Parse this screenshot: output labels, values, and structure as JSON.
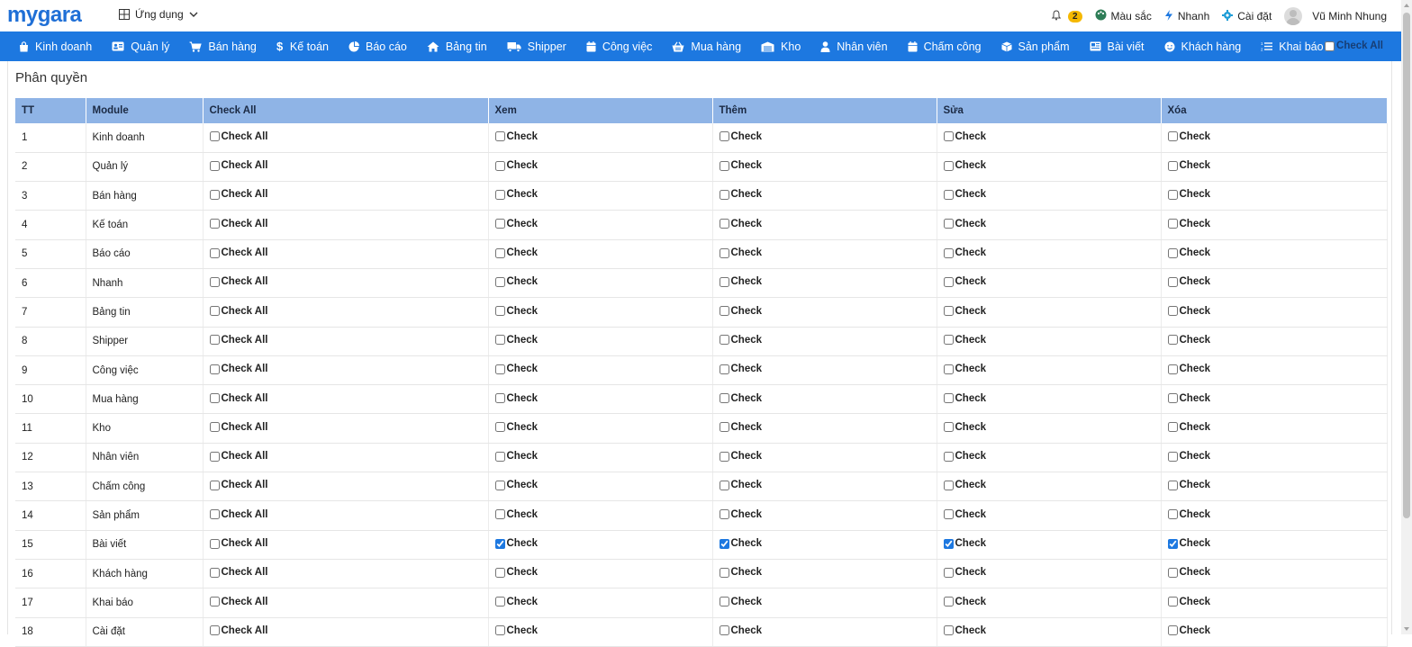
{
  "header": {
    "logo_part1": "my",
    "logo_part2": "gara",
    "apps_label": "Ứng dụng",
    "notification_count": "2",
    "color_label": "Màu sắc",
    "quick_label": "Nhanh",
    "settings_label": "Cài đặt",
    "user_name": "Vũ Minh Nhung"
  },
  "nav": {
    "items": [
      {
        "label": "Kinh doanh",
        "icon": "shopping-bag-icon"
      },
      {
        "label": "Quản lý",
        "icon": "id-card-icon"
      },
      {
        "label": "Bán hàng",
        "icon": "cart-icon"
      },
      {
        "label": "Kế toán",
        "icon": "dollar-icon"
      },
      {
        "label": "Báo cáo",
        "icon": "pie-chart-icon"
      },
      {
        "label": "Bảng tin",
        "icon": "home-icon"
      },
      {
        "label": "Shipper",
        "icon": "truck-icon"
      },
      {
        "label": "Công việc",
        "icon": "calendar-icon"
      },
      {
        "label": "Mua hàng",
        "icon": "basket-icon"
      },
      {
        "label": "Kho",
        "icon": "warehouse-icon"
      },
      {
        "label": "Nhân viên",
        "icon": "user-icon"
      },
      {
        "label": "Chấm công",
        "icon": "calendar-icon"
      },
      {
        "label": "Sản phẩm",
        "icon": "box-icon"
      },
      {
        "label": "Bài viết",
        "icon": "newspaper-icon"
      },
      {
        "label": "Khách hàng",
        "icon": "smile-icon"
      },
      {
        "label": "Khai báo",
        "icon": "list-icon"
      }
    ],
    "check_all_label": "Check All"
  },
  "page": {
    "title": "Phân quyền"
  },
  "table": {
    "headers": {
      "tt": "TT",
      "module": "Module",
      "check_all": "Check All",
      "view": "Xem",
      "add": "Thêm",
      "edit": "Sửa",
      "delete": "Xóa"
    },
    "check_all_label": "Check All",
    "check_label": "Check",
    "rows": [
      {
        "tt": "1",
        "module": "Kinh doanh",
        "view": false,
        "add": false,
        "edit": false,
        "delete": false
      },
      {
        "tt": "2",
        "module": "Quản lý",
        "view": false,
        "add": false,
        "edit": false,
        "delete": false
      },
      {
        "tt": "3",
        "module": "Bán hàng",
        "view": false,
        "add": false,
        "edit": false,
        "delete": false
      },
      {
        "tt": "4",
        "module": "Kế toán",
        "view": false,
        "add": false,
        "edit": false,
        "delete": false
      },
      {
        "tt": "5",
        "module": "Báo cáo",
        "view": false,
        "add": false,
        "edit": false,
        "delete": false
      },
      {
        "tt": "6",
        "module": "Nhanh",
        "view": false,
        "add": false,
        "edit": false,
        "delete": false
      },
      {
        "tt": "7",
        "module": "Bảng tin",
        "view": false,
        "add": false,
        "edit": false,
        "delete": false
      },
      {
        "tt": "8",
        "module": "Shipper",
        "view": false,
        "add": false,
        "edit": false,
        "delete": false
      },
      {
        "tt": "9",
        "module": "Công việc",
        "view": false,
        "add": false,
        "edit": false,
        "delete": false
      },
      {
        "tt": "10",
        "module": "Mua hàng",
        "view": false,
        "add": false,
        "edit": false,
        "delete": false
      },
      {
        "tt": "11",
        "module": "Kho",
        "view": false,
        "add": false,
        "edit": false,
        "delete": false
      },
      {
        "tt": "12",
        "module": "Nhân viên",
        "view": false,
        "add": false,
        "edit": false,
        "delete": false
      },
      {
        "tt": "13",
        "module": "Chấm công",
        "view": false,
        "add": false,
        "edit": false,
        "delete": false
      },
      {
        "tt": "14",
        "module": "Sản phẩm",
        "view": false,
        "add": false,
        "edit": false,
        "delete": false
      },
      {
        "tt": "15",
        "module": "Bài viết",
        "view": true,
        "add": true,
        "edit": true,
        "delete": true
      },
      {
        "tt": "16",
        "module": "Khách hàng",
        "view": false,
        "add": false,
        "edit": false,
        "delete": false
      },
      {
        "tt": "17",
        "module": "Khai báo",
        "view": false,
        "add": false,
        "edit": false,
        "delete": false
      },
      {
        "tt": "18",
        "module": "Cài đặt",
        "view": false,
        "add": false,
        "edit": false,
        "delete": false
      }
    ]
  },
  "colors": {
    "nav_bg": "#1d78e0",
    "table_header_bg": "#8fb4e6",
    "logo": "#1f6fd6",
    "badge": "#f5b800"
  }
}
